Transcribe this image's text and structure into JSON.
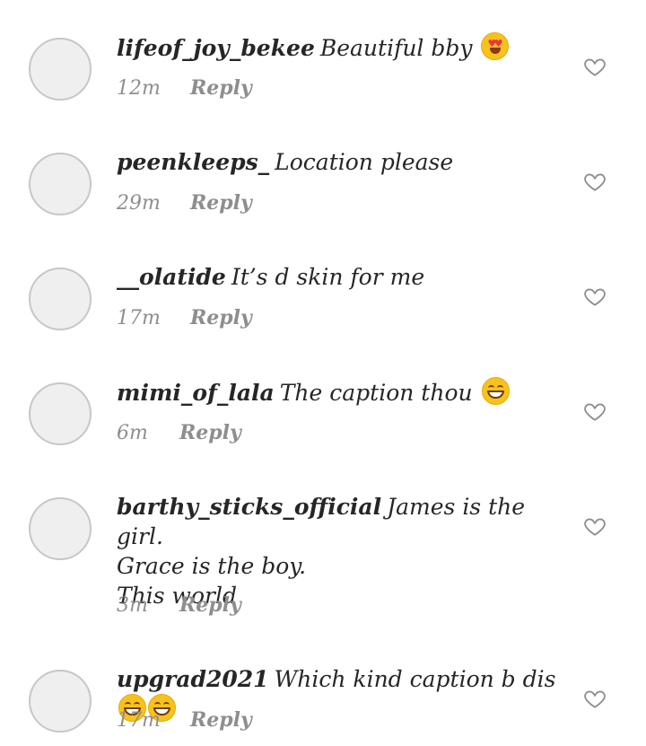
{
  "comments": [
    {
      "username": "lifeof_joy_bekee",
      "text": "Beautiful bby",
      "emoji": [
        "heart-eyes"
      ],
      "time": "12m",
      "reply": "Reply"
    },
    {
      "username": "peenkleeps_",
      "text": "Location please",
      "emoji": [],
      "time": "29m",
      "reply": "Reply"
    },
    {
      "username": "__olatide",
      "text": "It’s d skin for me",
      "emoji": [],
      "time": "17m",
      "reply": "Reply"
    },
    {
      "username": "mimi_of_lala",
      "text": "The caption thou",
      "emoji": [
        "grin"
      ],
      "time": "6m",
      "reply": "Reply"
    },
    {
      "username": "barthy_sticks_official",
      "text": "James is the girl.\nGrace is the boy.\nThis world",
      "emoji": [],
      "time": "3m",
      "reply": "Reply"
    },
    {
      "username": "upgrad2021",
      "text": "Which kind caption b dis",
      "emoji": [
        "grin",
        "grin"
      ],
      "time": "17m",
      "reply": "Reply"
    }
  ]
}
